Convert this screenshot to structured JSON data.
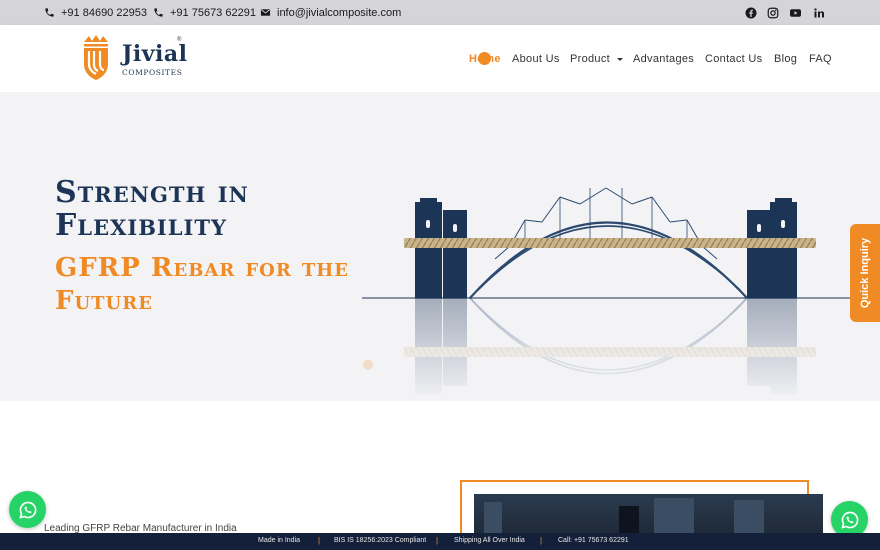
{
  "topbar": {
    "phone1": "+91 84690 22953",
    "phone2": "+91 75673 62291",
    "email": "info@jivialcomposite.com",
    "social": [
      "facebook-icon",
      "instagram-icon",
      "youtube-icon",
      "linkedin-icon"
    ]
  },
  "brand": {
    "name": "Jivial",
    "sub": "COMPOSITES",
    "accent": "#f08a24",
    "navy": "#1c3455"
  },
  "nav": {
    "items": [
      "Home",
      "About Us",
      "Product",
      "Advantages",
      "Contact Us",
      "Blog",
      "FAQ"
    ],
    "active": "Home"
  },
  "hero": {
    "title": "Strength in Flexibility",
    "subtitle": "GFRP Rebar for the Future"
  },
  "quick_inquiry": "Quick Inquiry",
  "about": {
    "label": "Leading GFRP Rebar Manufacturer in India"
  },
  "strip": {
    "items": [
      "Made in India",
      "BIS IS 18256:2023 Compliant",
      "Shipping All Over India",
      "Call: +91 75673 62291"
    ]
  }
}
